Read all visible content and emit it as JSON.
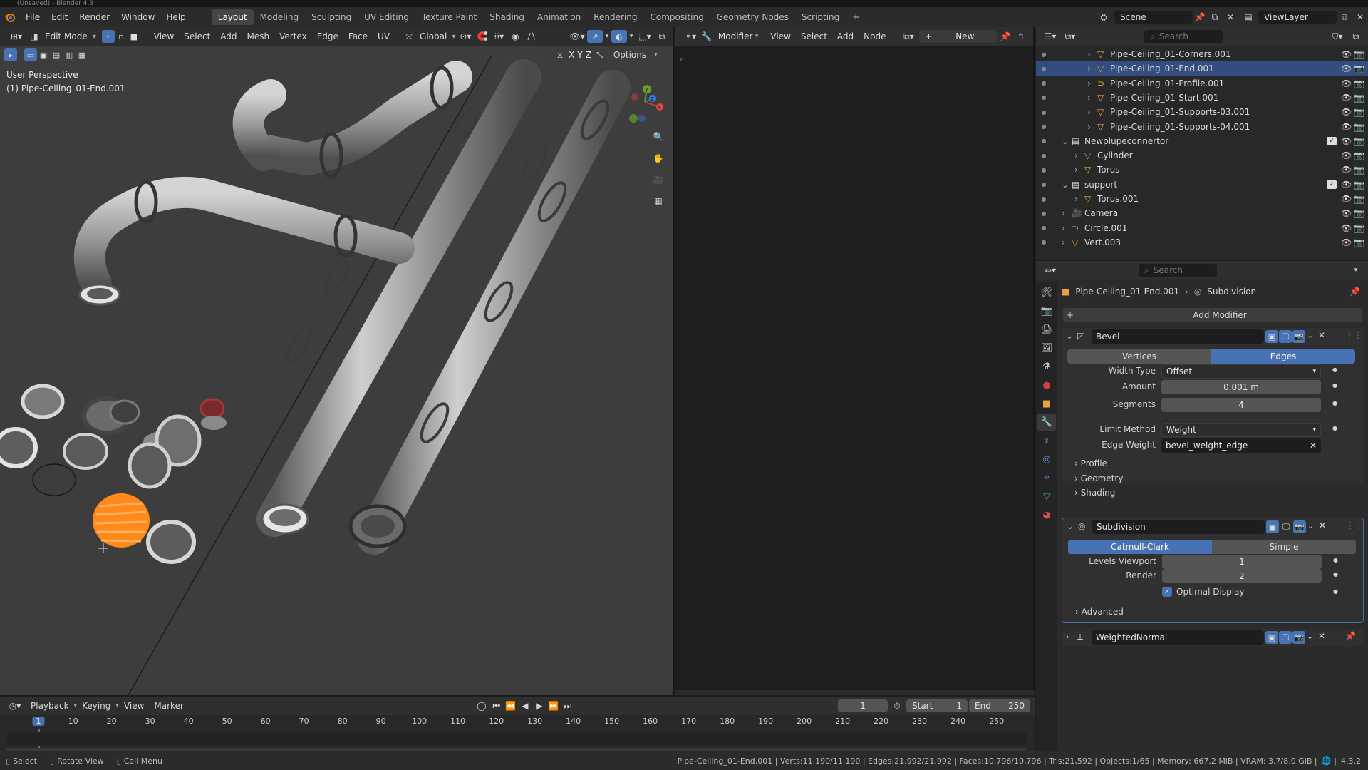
{
  "window": {
    "title": "(Unsaved) - Blender 4.3"
  },
  "topbar": {
    "menus": [
      "File",
      "Edit",
      "Render",
      "Window",
      "Help"
    ],
    "workspaces": [
      "Layout",
      "Modeling",
      "Sculpting",
      "UV Editing",
      "Texture Paint",
      "Shading",
      "Animation",
      "Rendering",
      "Compositing",
      "Geometry Nodes",
      "Scripting"
    ],
    "active_workspace": "Layout",
    "scene": "Scene",
    "view_layer": "ViewLayer"
  },
  "viewport": {
    "mode": "Edit Mode",
    "menus": [
      "View",
      "Select",
      "Add",
      "Mesh",
      "Vertex",
      "Edge",
      "Face",
      "UV"
    ],
    "transform_orientation": "Global",
    "overlay_title": "User Perspective",
    "overlay_object": "(1) Pipe-Ceiling_01-End.001",
    "axis_labels": [
      "X",
      "Y",
      "Z"
    ],
    "options_label": "Options",
    "gizmo": {
      "x": "X",
      "y": "Y",
      "z": "Z"
    }
  },
  "node_editor": {
    "editor_type": "Modifier",
    "menus": [
      "View",
      "Select",
      "Add",
      "Node"
    ],
    "new_label": "New"
  },
  "outliner": {
    "search_placeholder": "Search",
    "rows": [
      {
        "name": "Pipe-Ceiling_01-Corners.001",
        "indent": 3,
        "icon": "mesh",
        "selected": false
      },
      {
        "name": "Pipe-Ceiling_01-End.001",
        "indent": 3,
        "icon": "mesh",
        "selected": true
      },
      {
        "name": "Pipe-Ceiling_01-Profile.001",
        "indent": 3,
        "icon": "curve",
        "selected": false
      },
      {
        "name": "Pipe-Ceiling_01-Start.001",
        "indent": 3,
        "icon": "mesh",
        "selected": false
      },
      {
        "name": "Pipe-Ceiling_01-Supports-03.001",
        "indent": 3,
        "icon": "mesh",
        "selected": false
      },
      {
        "name": "Pipe-Ceiling_01-Supports-04.001",
        "indent": 3,
        "icon": "mesh",
        "selected": false
      },
      {
        "name": "Newplupeconnertor",
        "indent": 1,
        "icon": "collection",
        "selected": false
      },
      {
        "name": "Cylinder",
        "indent": 2,
        "icon": "mesh",
        "selected": false
      },
      {
        "name": "Torus",
        "indent": 2,
        "icon": "mesh",
        "selected": false
      },
      {
        "name": "support",
        "indent": 1,
        "icon": "collection",
        "selected": false
      },
      {
        "name": "Torus.001",
        "indent": 2,
        "icon": "mesh",
        "selected": false
      },
      {
        "name": "Camera",
        "indent": 1,
        "icon": "camera",
        "selected": false
      },
      {
        "name": "Circle.001",
        "indent": 1,
        "icon": "curve",
        "selected": false
      },
      {
        "name": "Vert.003",
        "indent": 1,
        "icon": "mesh",
        "selected": false
      }
    ]
  },
  "properties": {
    "search_placeholder": "Search",
    "breadcrumb_object": "Pipe-Ceiling_01-End.001",
    "breadcrumb_modifier": "Subdivision",
    "add_modifier": "Add Modifier",
    "bevel": {
      "name": "Bevel",
      "tab_vertices": "Vertices",
      "tab_edges": "Edges",
      "width_type_label": "Width Type",
      "width_type": "Offset",
      "amount_label": "Amount",
      "amount": "0.001 m",
      "segments_label": "Segments",
      "segments": "4",
      "limit_method_label": "Limit Method",
      "limit_method": "Weight",
      "edge_weight_label": "Edge Weight",
      "edge_weight": "bevel_weight_edge",
      "sub_profile": "Profile",
      "sub_geometry": "Geometry",
      "sub_shading": "Shading"
    },
    "subdivision": {
      "name": "Subdivision",
      "tab_catmull": "Catmull-Clark",
      "tab_simple": "Simple",
      "levels_viewport_label": "Levels Viewport",
      "levels_viewport": "1",
      "render_label": "Render",
      "render": "2",
      "optimal_display": "Optimal Display",
      "advanced": "Advanced"
    },
    "weighted_normal": {
      "name": "WeightedNormal"
    }
  },
  "timeline": {
    "menus": [
      "Playback",
      "Keying",
      "View",
      "Marker"
    ],
    "current_frame": "1",
    "start_label": "Start",
    "start": "1",
    "end_label": "End",
    "end": "250",
    "ticks": [
      "1",
      "10",
      "20",
      "30",
      "40",
      "50",
      "60",
      "70",
      "80",
      "90",
      "100",
      "110",
      "120",
      "130",
      "140",
      "150",
      "160",
      "170",
      "180",
      "190",
      "200",
      "210",
      "220",
      "230",
      "240",
      "250"
    ]
  },
  "statusbar": {
    "select": "Select",
    "rotate_view": "Rotate View",
    "call_menu": "Call Menu",
    "stats": "Pipe-Ceiling_01-End.001 | Verts:11,190/11,190 | Edges:21,992/21,992 | Faces:10,796/10,796 | Tris:21,592 | Objects:1/65 | Memory: 667.2 MiB | VRAM: 3.7/8.0 GiB |",
    "version": "4.3.2"
  },
  "colors": {
    "accent": "#4772b3",
    "selection_orange": "#ff8a1a",
    "viewport_bg": "#3d3d3d"
  }
}
